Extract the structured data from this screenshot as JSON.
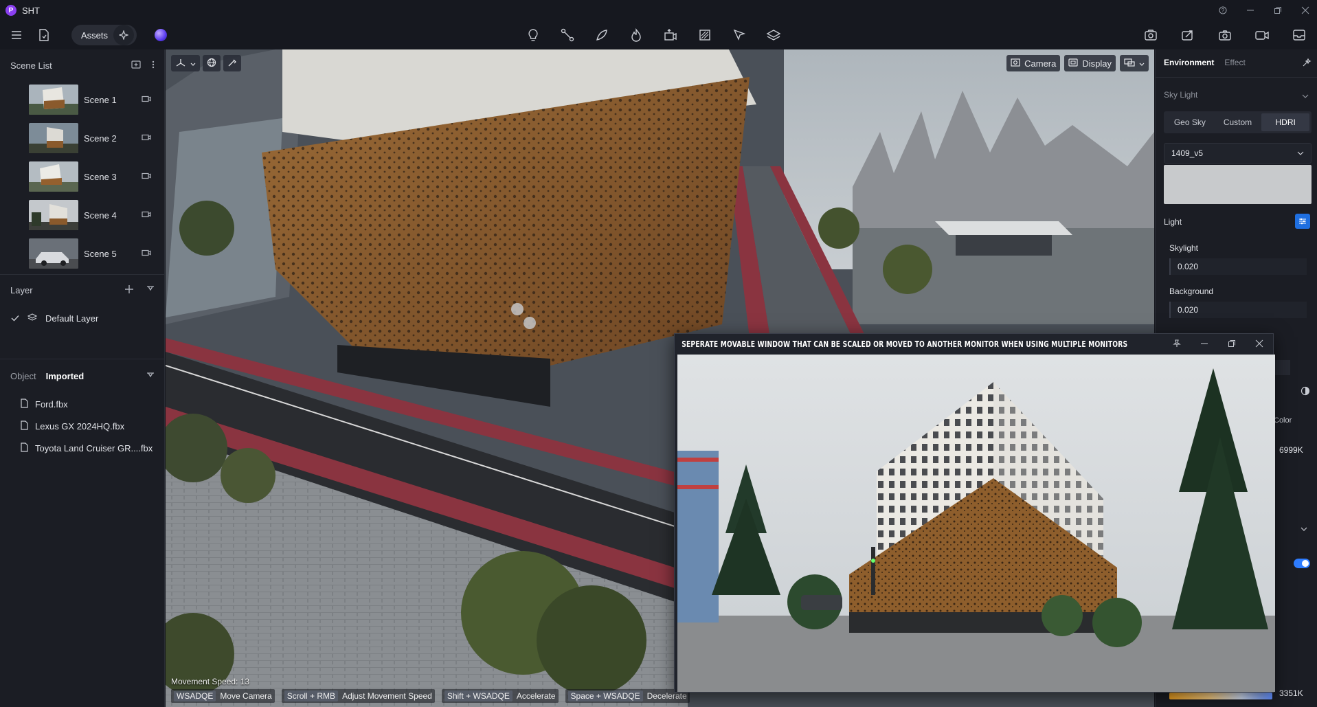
{
  "app": {
    "logo_letter": "P",
    "title": "SHT"
  },
  "window_controls": [
    "help-icon",
    "minimize-icon",
    "restore-icon",
    "close-icon"
  ],
  "toolbar": {
    "assets_label": "Assets",
    "center_icons": [
      "light-bulb-icon",
      "path-icon",
      "draw-icon",
      "effect-icon",
      "camera-path-icon",
      "section-icon",
      "annotate-icon",
      "layers-icon"
    ],
    "right_icons": [
      "render-icon",
      "share-icon",
      "screenshot-icon",
      "video-icon",
      "inbox-icon"
    ]
  },
  "scene_list": {
    "title": "Scene List",
    "scenes": [
      {
        "name": "Scene 1"
      },
      {
        "name": "Scene 2"
      },
      {
        "name": "Scene 3"
      },
      {
        "name": "Scene 4"
      },
      {
        "name": "Scene 5"
      }
    ]
  },
  "layer": {
    "title": "Layer",
    "items": [
      {
        "name": "Default Layer",
        "checked": true
      }
    ]
  },
  "objects": {
    "tab_object": "Object",
    "tab_imported": "Imported",
    "files": [
      "Ford.fbx",
      "Lexus GX 2024HQ.fbx",
      "Toyota Land Cruiser GR....fbx"
    ]
  },
  "viewport": {
    "camera_label": "Camera",
    "display_label": "Display",
    "movement_speed": "Movement Speed: 13",
    "hints": [
      {
        "key": "WSADQE",
        "action": "Move Camera"
      },
      {
        "key": "Scroll + RMB",
        "action": "Adjust Movement Speed"
      },
      {
        "key": "Shift + WSADQE",
        "action": "Accelerate"
      },
      {
        "key": "Space + WSADQE",
        "action": "Decelerate"
      }
    ]
  },
  "floating_window": {
    "title": "SEPERATE MOVABLE WINDOW THAT CAN BE SCALED OR MOVED TO ANOTHER MONITOR WHEN USING MULTIPLE MONITORS"
  },
  "right_panel": {
    "tab_environment": "Environment",
    "tab_effect": "Effect",
    "sky_light_label": "Sky Light",
    "sky_modes": [
      "Geo Sky",
      "Custom",
      "HDRI"
    ],
    "sky_mode_active": "HDRI",
    "hdri_value": "1409_v5",
    "light_label": "Light",
    "skylight_label": "Skylight",
    "skylight_value": "0.020",
    "background_label": "Background",
    "background_value": "0.020",
    "color_label_partial": "Color",
    "color_temp_top": "6999K",
    "color_temp_bottom": "3351K",
    "toggle_on": true
  }
}
